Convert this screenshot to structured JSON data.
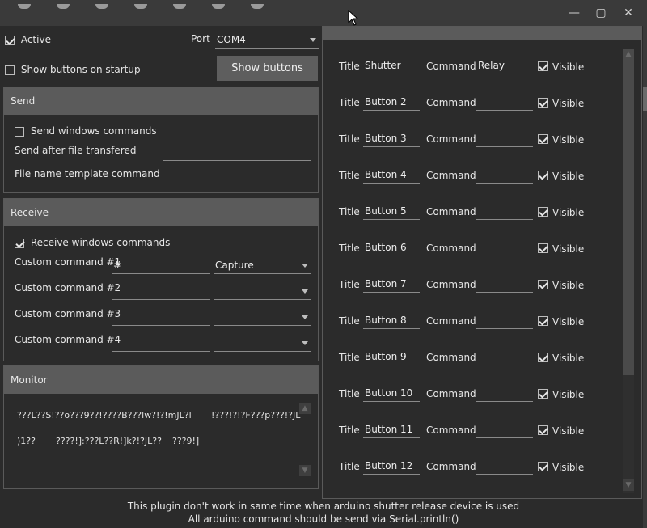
{
  "titlebar": {
    "minimize": "—",
    "maximize": "▢",
    "close": "✕"
  },
  "general": {
    "active_label": "Active",
    "port_label": "Port",
    "port_value": "COM4",
    "show_on_startup_label": "Show buttons on startup",
    "show_buttons_label": "Show buttons"
  },
  "send": {
    "header": "Send",
    "windows_commands_label": "Send windows commands",
    "after_file_label": "Send after file transfered",
    "after_file_value": "",
    "template_label": "File name template command",
    "template_value": ""
  },
  "receive": {
    "header": "Receive",
    "windows_commands_label": "Receive windows commands",
    "commands": [
      {
        "label": "Custom command #1",
        "value": "#",
        "action": "Capture"
      },
      {
        "label": "Custom command #2",
        "value": "",
        "action": ""
      },
      {
        "label": "Custom command #3",
        "value": "",
        "action": ""
      },
      {
        "label": "Custom command #4",
        "value": "",
        "action": ""
      }
    ]
  },
  "monitor": {
    "header": "Monitor",
    "line1a": "???L??S!??o???9??!????B???lw?!?!mJL?l",
    "line1b": "!???!?!?F???p???!?JL",
    "line2a": ")1??",
    "line2b": "????!]:???L??R!]k?!?JL??",
    "line2c": "???9!]"
  },
  "buttons_panel": {
    "title_label": "Title",
    "command_label": "Command",
    "visible_label": "Visible",
    "items": [
      {
        "title": "Shutter",
        "command": "Relay",
        "visible": true
      },
      {
        "title": "Button 2",
        "command": "",
        "visible": true
      },
      {
        "title": "Button 3",
        "command": "",
        "visible": true
      },
      {
        "title": "Button 4",
        "command": "",
        "visible": true
      },
      {
        "title": "Button 5",
        "command": "",
        "visible": true
      },
      {
        "title": "Button 6",
        "command": "",
        "visible": true
      },
      {
        "title": "Button 7",
        "command": "",
        "visible": true
      },
      {
        "title": "Button 8",
        "command": "",
        "visible": true
      },
      {
        "title": "Button 9",
        "command": "",
        "visible": true
      },
      {
        "title": "Button 10",
        "command": "",
        "visible": true
      },
      {
        "title": "Button 11",
        "command": "",
        "visible": true
      },
      {
        "title": "Button 12",
        "command": "",
        "visible": true
      }
    ]
  },
  "footer": {
    "line1": "This plugin don't work in same time when arduino shutter release device is used",
    "line2": "All arduino command should be send via Serial.println()"
  }
}
